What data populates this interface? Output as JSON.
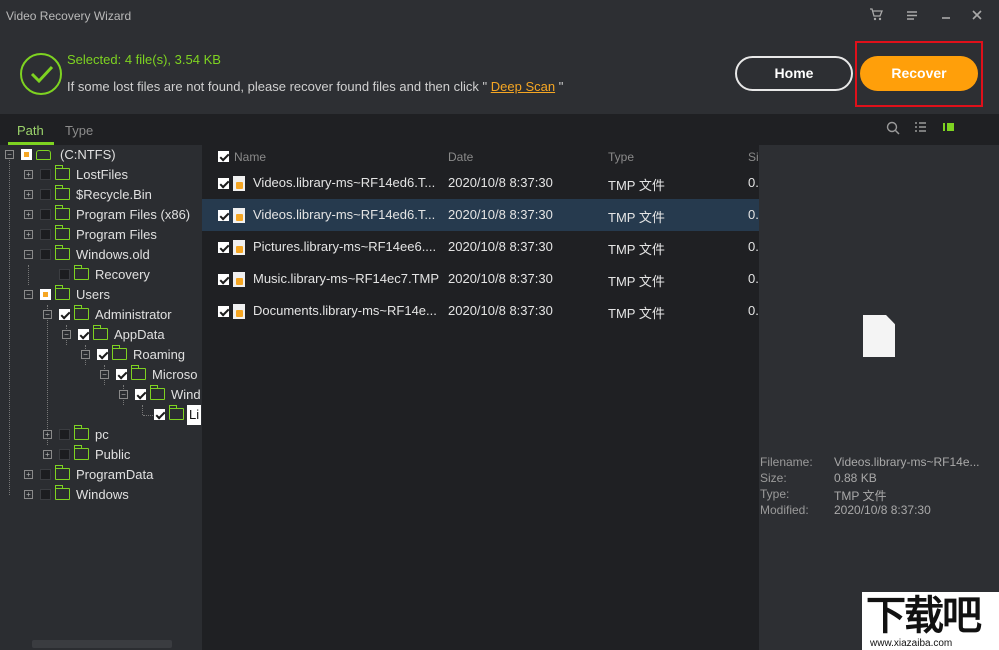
{
  "window": {
    "title": "Video Recovery Wizard",
    "controls": [
      "cart-icon",
      "menu-icon",
      "minimize-icon",
      "close-icon"
    ]
  },
  "header": {
    "selected_text": "Selected: 4 file(s), 3.54 KB",
    "hint_prefix": "If some lost files are not found, please recover found files and then click \"",
    "deep_scan_link": "Deep Scan",
    "hint_suffix": "\"",
    "home_label": "Home",
    "recover_label": "Recover"
  },
  "tabs": [
    {
      "label": "Path",
      "active": true
    },
    {
      "label": "Type",
      "active": false
    }
  ],
  "view_icons": [
    "search-icon",
    "list-view-icon",
    "detail-view-icon"
  ],
  "tree": {
    "root": "(C:NTFS)",
    "items": [
      {
        "label": "LostFiles"
      },
      {
        "label": "$Recycle.Bin"
      },
      {
        "label": "Program Files (x86)"
      },
      {
        "label": "Program Files"
      },
      {
        "label": "Windows.old"
      },
      {
        "label": "Recovery"
      },
      {
        "label": "Users"
      },
      {
        "label": "Administrator"
      },
      {
        "label": "AppData"
      },
      {
        "label": "Roaming"
      },
      {
        "label": "Microso"
      },
      {
        "label": "Wind"
      },
      {
        "label": "Li"
      },
      {
        "label": "pc"
      },
      {
        "label": "Public"
      },
      {
        "label": "ProgramData"
      },
      {
        "label": "Windows"
      }
    ]
  },
  "filelist": {
    "columns": [
      "Name",
      "Date",
      "Type",
      "Si"
    ],
    "rows": [
      {
        "name": "Videos.library-ms~RF14ed6.T...",
        "date": "2020/10/8 8:37:30",
        "type": "TMP 文件",
        "size": "0.",
        "selected": false
      },
      {
        "name": "Videos.library-ms~RF14ed6.T...",
        "date": "2020/10/8 8:37:30",
        "type": "TMP 文件",
        "size": "0.",
        "selected": true
      },
      {
        "name": "Pictures.library-ms~RF14ee6....",
        "date": "2020/10/8 8:37:30",
        "type": "TMP 文件",
        "size": "0.",
        "selected": false
      },
      {
        "name": "Music.library-ms~RF14ec7.TMP",
        "date": "2020/10/8 8:37:30",
        "type": "TMP 文件",
        "size": "0.",
        "selected": false
      },
      {
        "name": "Documents.library-ms~RF14e...",
        "date": "2020/10/8 8:37:30",
        "type": "TMP 文件",
        "size": "0.",
        "selected": false
      }
    ]
  },
  "preview": {
    "filename_label": "Filename:",
    "filename_value": "Videos.library-ms~RF14e...",
    "size_label": "Size:",
    "size_value": "0.88 KB",
    "type_label": "Type:",
    "type_value": "TMP 文件",
    "modified_label": "Modified:",
    "modified_value": "2020/10/8 8:37:30"
  },
  "watermark": {
    "brand": "下载吧",
    "url": "www.xiazaiba.com"
  },
  "colors": {
    "accent_green": "#7ed321",
    "recover_orange": "#ff9f0a",
    "highlight_red": "#e0101a",
    "selected_row": "#263a4e"
  }
}
